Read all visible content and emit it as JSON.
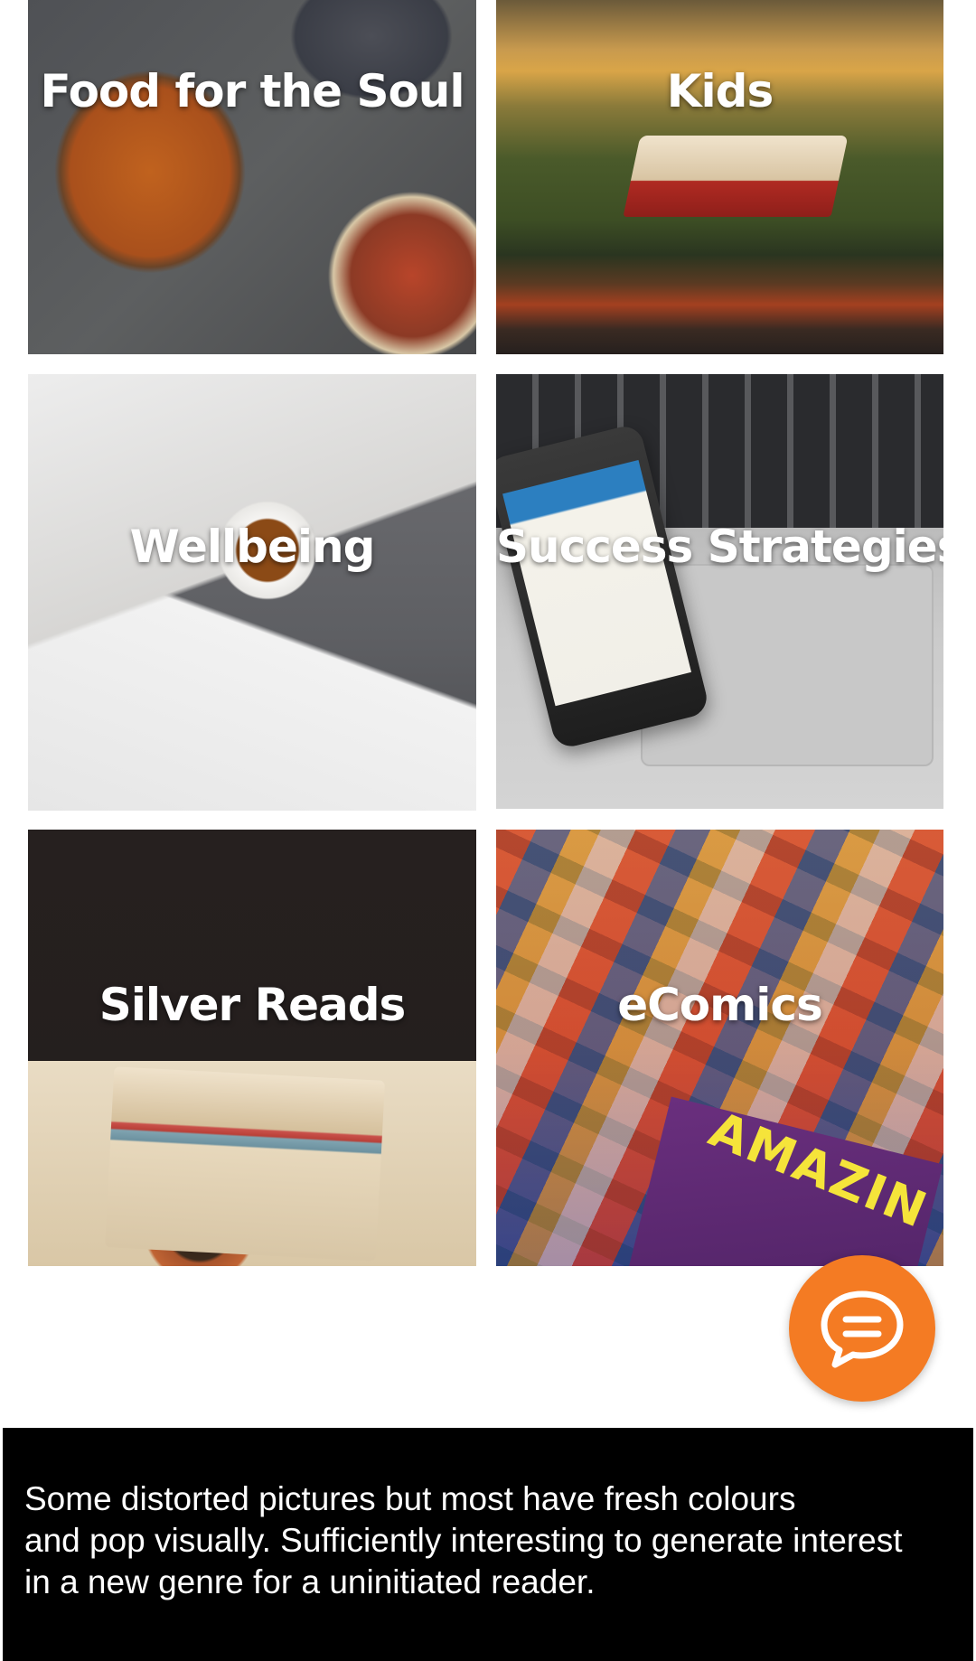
{
  "tiles": [
    {
      "id": "food",
      "label": "Food for the Soul"
    },
    {
      "id": "kids",
      "label": "Kids"
    },
    {
      "id": "wellbeing",
      "label": "Wellbeing"
    },
    {
      "id": "success",
      "label": "Success Strategies"
    },
    {
      "id": "silver",
      "label": "Silver Reads"
    },
    {
      "id": "comics",
      "label": "eComics"
    }
  ],
  "comic_cover_text": "AMAZIN",
  "chat_button": {
    "icon": "chat-bubble-icon",
    "color": "#f47b23"
  },
  "caption": {
    "line1": "Some distorted pictures but most have fresh colours",
    "line2": "and pop visually. Sufficiently interesting to generate interest",
    "line3": "in a new genre for a uninitiated reader."
  }
}
